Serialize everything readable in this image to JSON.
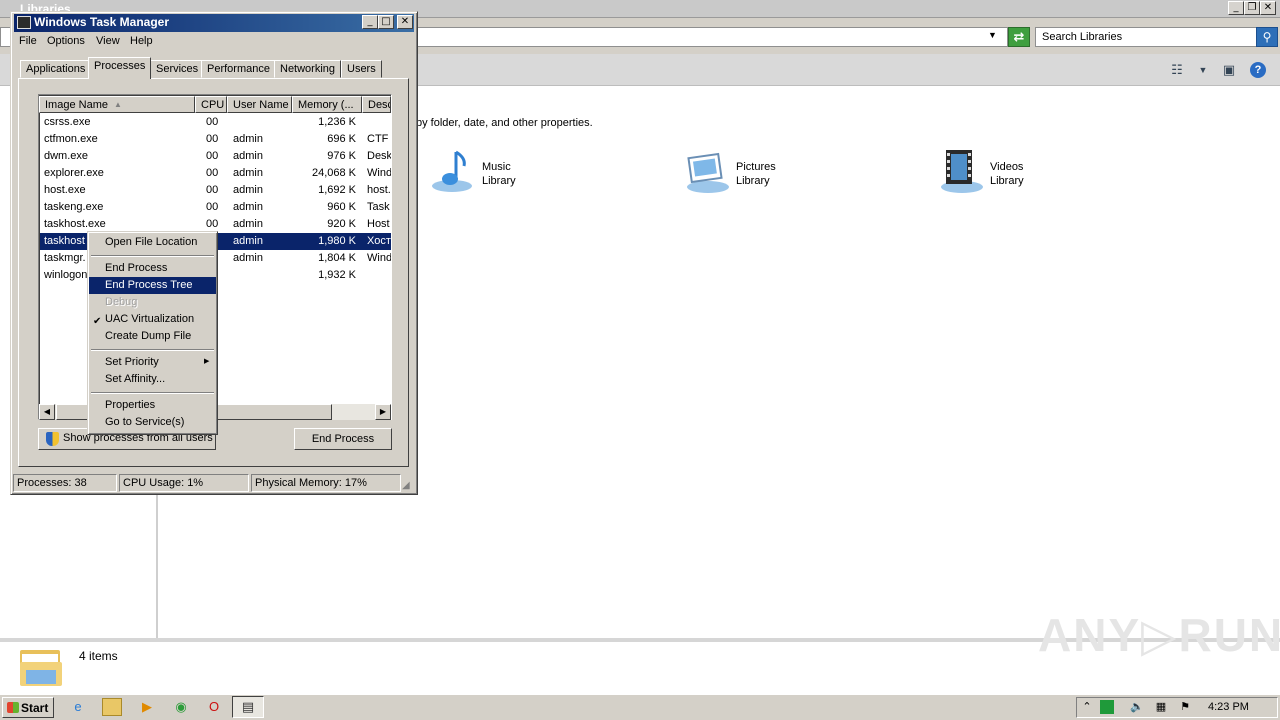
{
  "explorer": {
    "title": "Libraries",
    "search_placeholder": "Search Libraries",
    "description_fragment": "by folder, date, and other properties.",
    "libraries": [
      {
        "line1": "Music",
        "line2": "Library"
      },
      {
        "line1": "Pictures",
        "line2": "Library"
      },
      {
        "line1": "Videos",
        "line2": "Library"
      }
    ],
    "item_count": "4 items",
    "watermark": "ANY▷RUN"
  },
  "task_manager": {
    "title": "Windows Task Manager",
    "menu": [
      "File",
      "Options",
      "View",
      "Help"
    ],
    "tabs": [
      "Applications",
      "Processes",
      "Services",
      "Performance",
      "Networking",
      "Users"
    ],
    "active_tab": "Processes",
    "columns": [
      "Image Name",
      "CPU",
      "User Name",
      "Memory (...",
      "Desc"
    ],
    "processes": [
      {
        "name": "csrss.exe",
        "cpu": "00",
        "user": "",
        "memory": "1,236 K",
        "desc": ""
      },
      {
        "name": "ctfmon.exe",
        "cpu": "00",
        "user": "admin",
        "memory": "696 K",
        "desc": "CTF L"
      },
      {
        "name": "dwm.exe",
        "cpu": "00",
        "user": "admin",
        "memory": "976 K",
        "desc": "Desk"
      },
      {
        "name": "explorer.exe",
        "cpu": "00",
        "user": "admin",
        "memory": "24,068 K",
        "desc": "Wind"
      },
      {
        "name": "host.exe",
        "cpu": "00",
        "user": "admin",
        "memory": "1,692 K",
        "desc": "host."
      },
      {
        "name": "taskeng.exe",
        "cpu": "00",
        "user": "admin",
        "memory": "960 K",
        "desc": "Task"
      },
      {
        "name": "taskhost.exe",
        "cpu": "00",
        "user": "admin",
        "memory": "920 K",
        "desc": "Host"
      },
      {
        "name": "taskhost",
        "cpu": "",
        "user": "admin",
        "memory": "1,980 K",
        "desc": "Хост"
      },
      {
        "name": "taskmgr.",
        "cpu": "",
        "user": "admin",
        "memory": "1,804 K",
        "desc": "Wind"
      },
      {
        "name": "winlogon",
        "cpu": "",
        "user": "",
        "memory": "1,932 K",
        "desc": ""
      }
    ],
    "selected_row_index": 7,
    "show_all_label": "Show processes from all users",
    "end_process_label": "End Process",
    "status": {
      "processes": "Processes: 38",
      "cpu": "CPU Usage: 1%",
      "memory": "Physical Memory: 17%"
    }
  },
  "context_menu": {
    "items": [
      {
        "label": "Open File Location"
      },
      {
        "label": "End Process"
      },
      {
        "label": "End Process Tree",
        "highlighted": true
      },
      {
        "label": "Debug",
        "disabled": true
      },
      {
        "label": "UAC Virtualization",
        "checked": true
      },
      {
        "label": "Create Dump File"
      },
      {
        "label": "Set Priority",
        "submenu": true
      },
      {
        "label": "Set Affinity..."
      },
      {
        "label": "Properties"
      },
      {
        "label": "Go to Service(s)"
      }
    ]
  },
  "taskbar": {
    "start_label": "Start",
    "clock": "4:23 PM"
  }
}
